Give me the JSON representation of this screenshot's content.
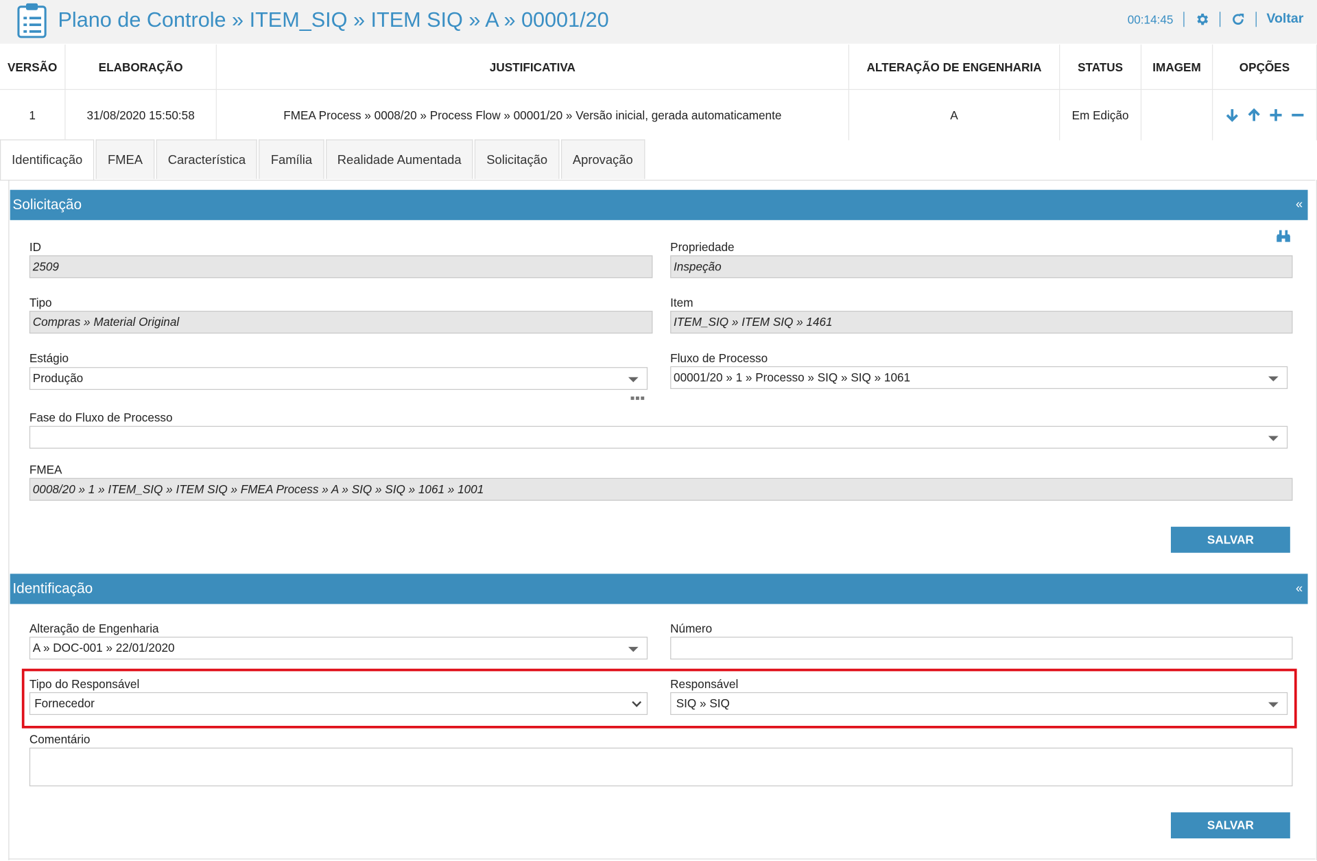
{
  "header": {
    "title": "Plano de Controle » ITEM_SIQ » ITEM SIQ » A » 00001/20",
    "timer": "00:14:45",
    "back_label": "Voltar",
    "icons": [
      "clipboard-icon",
      "gear-icon",
      "refresh-icon"
    ]
  },
  "version_table": {
    "columns": [
      "VERSÃO",
      "ELABORAÇÃO",
      "JUSTIFICATIVA",
      "ALTERAÇÃO DE ENGENHARIA",
      "STATUS",
      "IMAGEM",
      "OPÇÕES"
    ],
    "row": {
      "versao": "1",
      "elaboracao": "31/08/2020 15:50:58",
      "justificativa": "FMEA Process » 0008/20 » Process Flow » 00001/20 » Versão inicial, gerada automaticamente",
      "alteracao": "A",
      "status": "Em Edição",
      "imagem": ""
    },
    "option_icons": [
      "arrow-down-icon",
      "arrow-up-icon",
      "plus-icon",
      "minus-icon"
    ]
  },
  "tabs": [
    "Identificação",
    "FMEA",
    "Característica",
    "Família",
    "Realidade Aumentada",
    "Solicitação",
    "Aprovação"
  ],
  "solicitacao": {
    "title": "Solicitação",
    "collapse": "«",
    "id_label": "ID",
    "id_value": "2509",
    "propriedade_label": "Propriedade",
    "propriedade_value": "Inspeção",
    "tipo_label": "Tipo",
    "tipo_value": "Compras » Material Original",
    "item_label": "Item",
    "item_value": "ITEM_SIQ » ITEM SIQ » 1461",
    "estagio_label": "Estágio",
    "estagio_value": "Produção",
    "fluxo_label": "Fluxo de Processo",
    "fluxo_value": "00001/20 » 1 » Processo »  SIQ  »  SIQ  » 1061",
    "fase_label": "Fase do Fluxo de Processo",
    "fase_value": "",
    "fmea_label": "FMEA",
    "fmea_value": "0008/20 » 1 » ITEM_SIQ » ITEM SIQ » FMEA Process » A »  SIQ  »  SIQ  » 1061 » 1001",
    "save_label": "SALVAR"
  },
  "identificacao": {
    "title": "Identificação",
    "collapse": "«",
    "alteracao_label": "Alteração de Engenharia",
    "alteracao_value": "A » DOC-001 » 22/01/2020",
    "numero_label": "Número",
    "numero_value": "",
    "tipo_resp_label": "Tipo do Responsável",
    "tipo_resp_value": "Fornecedor",
    "responsavel_label": "Responsável",
    "responsavel_value": "SIQ  »  SIQ",
    "comentario_label": "Comentário",
    "comentario_value": "",
    "save_label": "SALVAR"
  },
  "colors": {
    "accent": "#3c8dbc",
    "title": "#3a8fc4",
    "highlight": "#e0101a"
  }
}
